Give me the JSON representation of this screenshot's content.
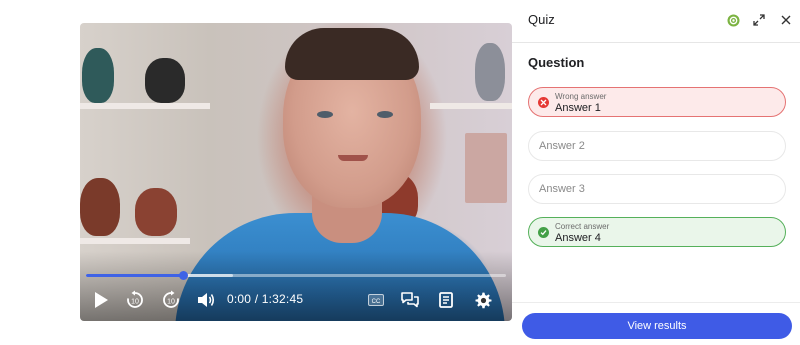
{
  "player": {
    "time_display": "0:00 / 1:32:45",
    "progress_fraction": 0.23,
    "buffered_fraction": 0.35,
    "skip_back_seconds": "10",
    "skip_forward_seconds": "10",
    "accent_color": "#3f63e6",
    "icons": [
      "play-icon",
      "rewind-10-icon",
      "forward-10-icon",
      "volume-icon",
      "captions-icon",
      "chat-icon",
      "notes-icon",
      "settings-icon"
    ]
  },
  "quiz": {
    "title": "Quiz",
    "question": "Question",
    "answers": [
      {
        "label": "Answer 1",
        "status": "wrong",
        "status_text": "Wrong answer"
      },
      {
        "label": "Answer 2",
        "status": "none"
      },
      {
        "label": "Answer 3",
        "status": "none"
      },
      {
        "label": "Answer 4",
        "status": "correct",
        "status_text": "Correct answer"
      }
    ],
    "view_results_label": "View results",
    "colors": {
      "wrong": "#e57373",
      "correct": "#55b05a",
      "button": "#3f5be6",
      "header_badge": "#7cb342"
    }
  }
}
